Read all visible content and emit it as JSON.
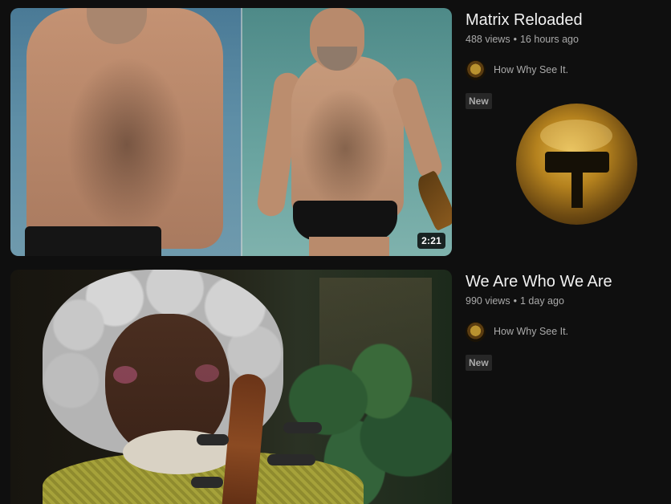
{
  "videos": [
    {
      "title": "Matrix Reloaded",
      "views": "488 views",
      "separator": "•",
      "age": "16 hours ago",
      "channel": "How Why See It.",
      "badge": "New",
      "duration": "2:21"
    },
    {
      "title": "We Are Who We Are",
      "views": "990 views",
      "separator": "•",
      "age": "1 day ago",
      "channel": "How Why See It.",
      "badge": "New"
    }
  ]
}
